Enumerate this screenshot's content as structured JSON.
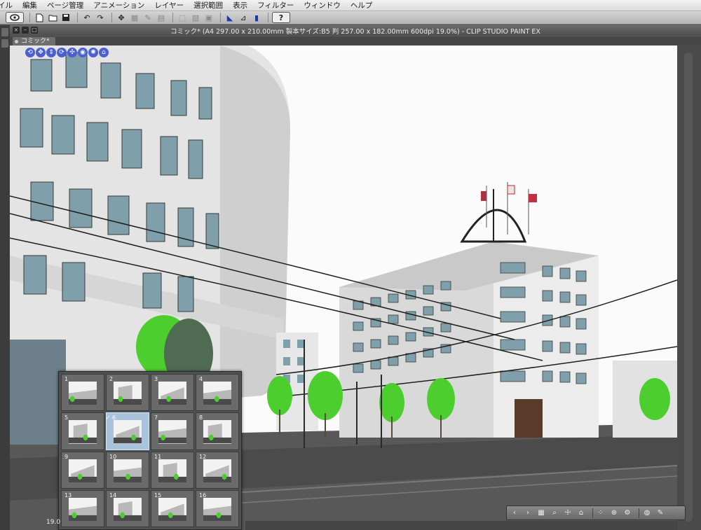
{
  "menu": [
    "イル",
    "編集",
    "ページ管理",
    "アニメーション",
    "レイヤー",
    "選択範囲",
    "表示",
    "フィルター",
    "ウィンドウ",
    "ヘルプ"
  ],
  "window": {
    "title": "コミック* (A4 297.00 x 210.00mm 製本サイズ:B5 判 257.00 x 182.00mm 600dpi 19.0%)  - CLIP STUDIO PAINT EX",
    "tab_label": "コミック*"
  },
  "toolbar": {
    "help_icon": "?"
  },
  "canvas": {
    "zoom_label": "19.0"
  },
  "pages": [
    {
      "num": "1",
      "selected": false
    },
    {
      "num": "2",
      "selected": false
    },
    {
      "num": "3",
      "selected": false
    },
    {
      "num": "4",
      "selected": false
    },
    {
      "num": "5",
      "selected": false
    },
    {
      "num": "6",
      "selected": true
    },
    {
      "num": "7",
      "selected": false
    },
    {
      "num": "8",
      "selected": false
    },
    {
      "num": "9",
      "selected": false
    },
    {
      "num": "10",
      "selected": false
    },
    {
      "num": "11",
      "selected": false
    },
    {
      "num": "12",
      "selected": false
    },
    {
      "num": "13",
      "selected": false
    },
    {
      "num": "14",
      "selected": false
    },
    {
      "num": "15",
      "selected": false
    },
    {
      "num": "16",
      "selected": false
    }
  ],
  "icons": {
    "toolbar": [
      "app-logo-icon",
      "new-file-icon",
      "open-file-icon",
      "save-icon",
      "undo-icon",
      "redo-icon",
      "transform-icon",
      "clear-icon",
      "fill-icon",
      "snap-ruler-icon",
      "snap-grid-icon",
      "snap-perspective-icon",
      "help-icon"
    ],
    "navigator": [
      "camera-orbit-icon",
      "camera-pan-icon",
      "camera-move-icon",
      "camera-rotate-icon",
      "object-move-icon",
      "object-rotate-icon",
      "light-icon",
      "scene-icon"
    ],
    "bottom": [
      "prev-icon",
      "next-icon",
      "list-icon",
      "camera-icon",
      "pose-icon",
      "material-icon",
      "grid-icon",
      "floor-icon",
      "settings-icon",
      "light-sphere-icon",
      "tool-icon"
    ]
  },
  "colors": {
    "accent": "#4b5fd0",
    "selected_page": "#a9c3dc",
    "panel_bg": "#515151"
  }
}
